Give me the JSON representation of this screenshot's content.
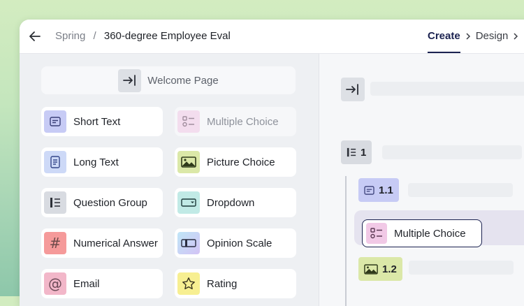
{
  "breadcrumb": {
    "parent": "Spring",
    "separator": "/",
    "title": "360-degree Employee Eval"
  },
  "steps": [
    {
      "label": "Create",
      "active": true
    },
    {
      "label": "Design",
      "active": false
    }
  ],
  "welcome": {
    "label": "Welcome Page",
    "icon": "enter-icon"
  },
  "palette": [
    {
      "label": "Short Text",
      "icon": "short-text-icon",
      "color": "#c7cbf5"
    },
    {
      "label": "Multiple Choice",
      "icon": "multiple-choice-icon",
      "color": "#f1c9e6",
      "disabled": true
    },
    {
      "label": "Long Text",
      "icon": "long-text-icon",
      "color": "#cdd9f7"
    },
    {
      "label": "Picture Choice",
      "icon": "image-icon",
      "color": "#dbe8a8"
    },
    {
      "label": "Question Group",
      "icon": "question-group-icon",
      "color": "#d8dbe1"
    },
    {
      "label": "Dropdown",
      "icon": "dropdown-icon",
      "color": "#c1eae6"
    },
    {
      "label": "Numerical Answer",
      "icon": "hash-icon",
      "color": "#f59a9a"
    },
    {
      "label": "Opinion Scale",
      "icon": "opinion-scale-icon",
      "color": "#d3c3f5"
    },
    {
      "label": "Email",
      "icon": "at-icon",
      "color": "#f2b7c9"
    },
    {
      "label": "Rating",
      "icon": "star-icon",
      "color": "#f7ef92"
    }
  ],
  "outline": {
    "group_label": "1",
    "items": [
      {
        "label": "1.1",
        "icon": "short-text-icon"
      },
      {
        "label": "Multiple Choice",
        "icon": "multiple-choice-icon",
        "dragging": true
      },
      {
        "label": "1.2",
        "icon": "image-icon"
      }
    ]
  },
  "colors": {
    "accent": "#1b2250"
  }
}
